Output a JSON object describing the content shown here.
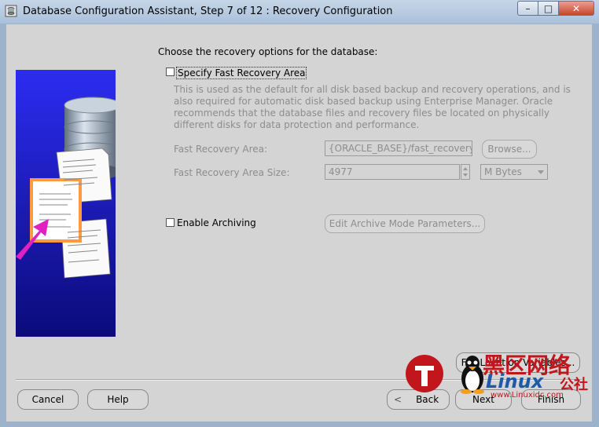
{
  "window": {
    "title": "Database Configuration Assistant, Step 7 of 12 : Recovery Configuration",
    "controls": {
      "minimize": "–",
      "maximize": "□",
      "close": "✕"
    }
  },
  "page": {
    "heading": "Choose the recovery options for the database:",
    "fast_recovery": {
      "checkbox_label": "Specify Fast Recovery Area",
      "checked": false,
      "description": "This is used as the default for all disk based backup and recovery operations, and is also required for automatic disk based backup using Enterprise Manager. Oracle recommends that the database files and recovery files be located on physically different disks for data protection and performance.",
      "area_label": "Fast Recovery Area:",
      "area_value": "{ORACLE_BASE}/fast_recovery_a",
      "browse_label": "Browse...",
      "size_label": "Fast Recovery Area Size:",
      "size_value": "4977",
      "unit_value": "M Bytes"
    },
    "archiving": {
      "checkbox_label": "Enable Archiving",
      "checked": false,
      "edit_button": "Edit Archive Mode Parameters..."
    },
    "file_location_button": "File Location Variables..."
  },
  "footer": {
    "cancel": "Cancel",
    "help": "Help",
    "back": "Back",
    "next": "Next",
    "finish": "Finish"
  },
  "watermark": {
    "chinese": "黑区网络",
    "brand": "Linux",
    "suffix": "公社",
    "url": "www.Linuxidc.com"
  },
  "colors": {
    "panel_bg": "#d4d4d4",
    "disabled_text": "#8d8d8d",
    "image_blue": "#1b1bd0",
    "arrow_magenta": "#e020c0",
    "watermark_red": "#c0161c",
    "watermark_blue": "#1f5aa8"
  }
}
